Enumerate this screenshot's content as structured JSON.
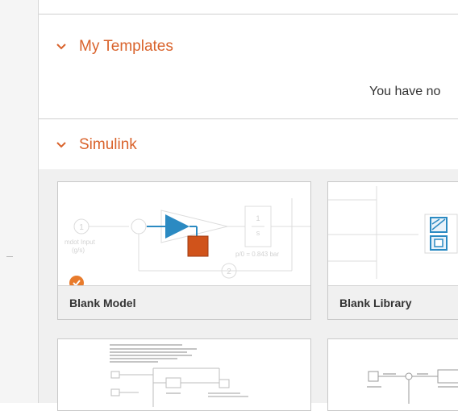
{
  "sections": [
    {
      "title": "My Templates",
      "empty_message": "You have no"
    },
    {
      "title": "Simulink"
    }
  ],
  "templates": [
    {
      "title": "Blank Model",
      "selected": true
    },
    {
      "title": "Blank Library"
    }
  ],
  "thumbnails": {
    "blank_model": {
      "inport_number": "1",
      "inport_label_line1": "mdot Input",
      "inport_label_line2": "(g/s)",
      "integrator_num": "1",
      "integrator_den": "s",
      "rho_label": "p/0 = 0.843 bar",
      "outport_number": "2"
    }
  },
  "colors": {
    "accent": "#d9632c",
    "check_badge": "#e87b2c",
    "gain_block": "#2b8ac2",
    "subsystem_block": "#d0531b"
  }
}
